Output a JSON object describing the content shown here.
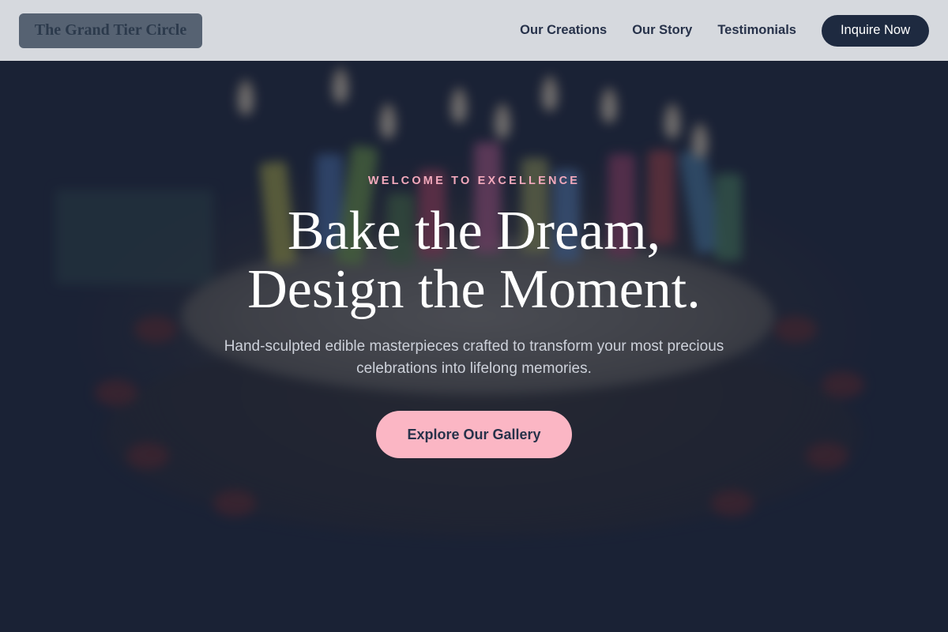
{
  "nav": {
    "brand": "The Grand Tier Circle",
    "links": [
      "Our Creations",
      "Our Story",
      "Testimonials"
    ],
    "cta_label": "Inquire Now"
  },
  "hero": {
    "eyebrow": "WELCOME TO EXCELLENCE",
    "headline_line1": "Bake the Dream,",
    "headline_line2": "Design the Moment.",
    "subtitle": "Hand-sculpted edible masterpieces crafted to transform your most precious celebrations into lifelong memories.",
    "button_label": "Explore Our Gallery"
  },
  "colors": {
    "accent_pink": "#fbb6c4",
    "eyebrow_pink": "#f2a9bc",
    "navy": "#1e2a40"
  }
}
